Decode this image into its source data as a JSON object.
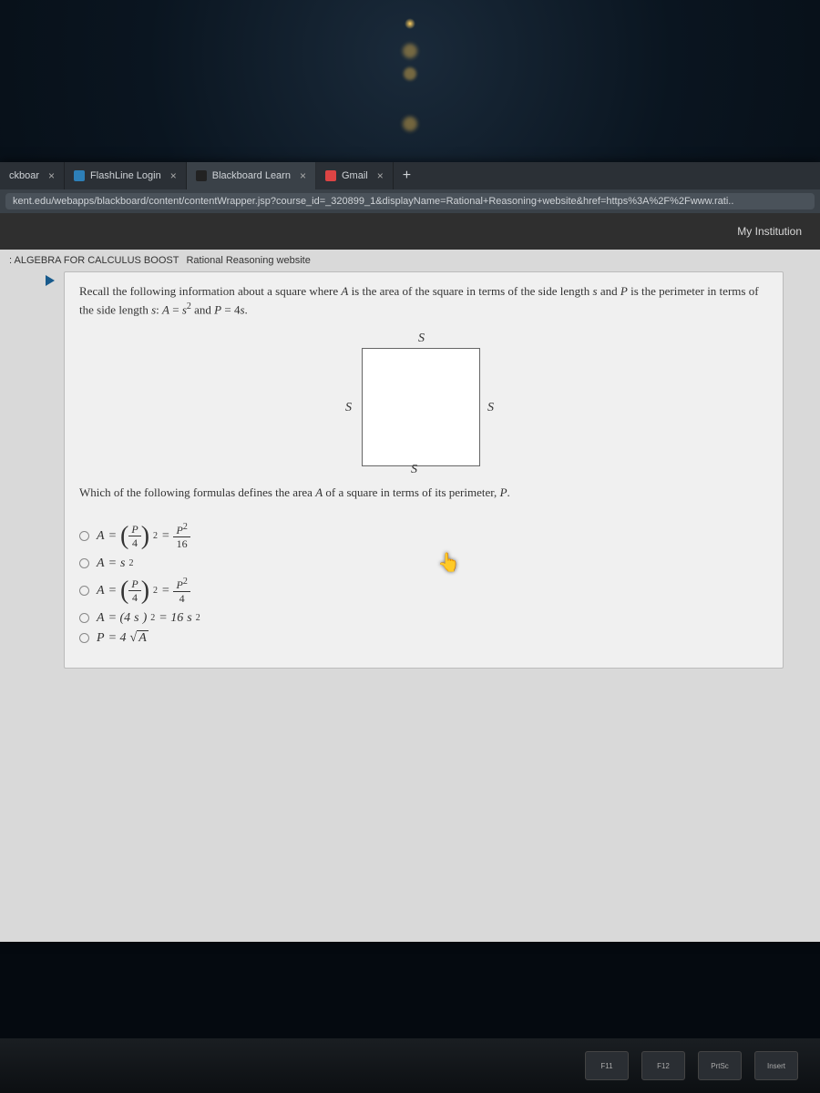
{
  "tabs": [
    {
      "label": "ckboar",
      "favicon": "#333"
    },
    {
      "label": "FlashLine Login",
      "favicon": "#2d7fb8"
    },
    {
      "label": "Blackboard Learn",
      "favicon": "#222",
      "active": true
    },
    {
      "label": "Gmail",
      "favicon": "#d44"
    }
  ],
  "address_bar": "kent.edu/webapps/blackboard/content/contentWrapper.jsp?course_id=_320899_1&displayName=Rational+Reasoning+website&href=https%3A%2F%2Fwww.rati..",
  "topnav": {
    "my_institution": "My Institution"
  },
  "breadcrumb": {
    "course": ": ALGEBRA FOR CALCULUS BOOST",
    "page": "Rational Reasoning website"
  },
  "question": {
    "prompt_1": "Recall the following information about a square where A is the area of the square in terms of the side length s and P is the perimeter in terms of the side length s: A = s² and P = 4s.",
    "figure_labels": {
      "top": "S",
      "left": "S",
      "right": "S",
      "bottom": "S"
    },
    "prompt_2": "Which of the following formulas defines the area A of a square in terms of its perimeter, P.",
    "options": [
      "A = (P/4)^2 = P^2 / 16",
      "A = s^2",
      "A = (P/4)^2 = P^2 / 4",
      "A = (4s)^2 = 16s^2",
      "P = 4√A"
    ]
  },
  "keyboard_keys": [
    "F11",
    "F12",
    "PrtSc",
    "Insert"
  ],
  "chart_data": {
    "type": "table",
    "title": "Multiple-choice options for square area in terms of perimeter",
    "rows": [
      {
        "label": "A",
        "expression": "(P/4)^2 = P^2/16"
      },
      {
        "label": "A",
        "expression": "s^2"
      },
      {
        "label": "A",
        "expression": "(P/4)^2 = P^2/4"
      },
      {
        "label": "A",
        "expression": "(4s)^2 = 16s^2"
      },
      {
        "label": "P",
        "expression": "4√A"
      }
    ]
  }
}
